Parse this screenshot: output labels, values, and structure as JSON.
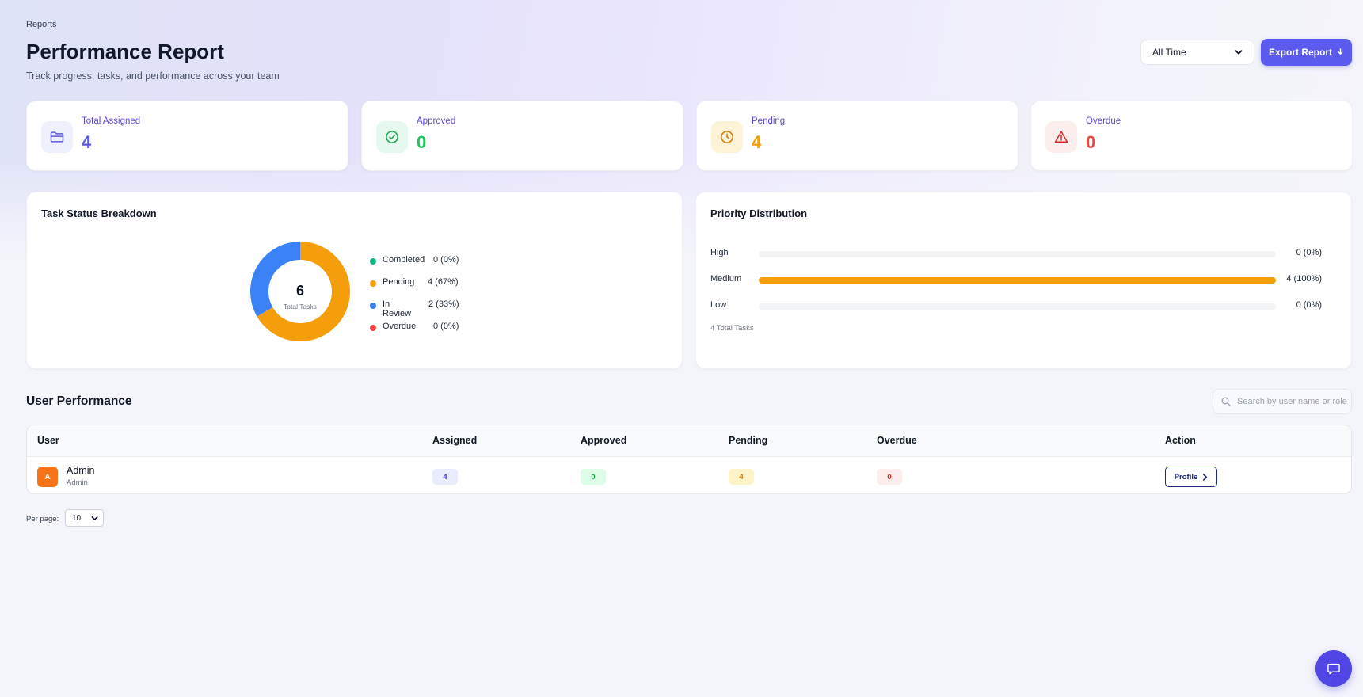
{
  "header": {
    "breadcrumb": "Reports",
    "title": "Performance Report",
    "subtitle": "Track progress, tasks, and performance across your team",
    "range_select": {
      "value": "All Time"
    },
    "export_label": "Export Report"
  },
  "stats": [
    {
      "label": "Total Assigned",
      "value": "4",
      "icon": "folder-icon",
      "color": "#5b5bd6",
      "icon_bg": "#eef0fb"
    },
    {
      "label": "Approved",
      "value": "0",
      "icon": "check-circle-icon",
      "color": "#22c55e",
      "icon_bg": "#e6f9ee"
    },
    {
      "label": "Pending",
      "value": "4",
      "icon": "clock-icon",
      "color": "#f59e0b",
      "icon_bg": "#fdf3d6"
    },
    {
      "label": "Overdue",
      "value": "0",
      "icon": "warning-icon",
      "color": "#ef4444",
      "icon_bg": "#fdeeee"
    }
  ],
  "status_breakdown": {
    "title": "Task Status Breakdown",
    "total_value": "6",
    "total_label": "Total Tasks",
    "legend": [
      {
        "label": "Completed",
        "value": "0 (0%)",
        "color": "#10b981"
      },
      {
        "label": "Pending",
        "value": "4 (67%)",
        "color": "#f59e0b"
      },
      {
        "label": "In Review",
        "value": "2 (33%)",
        "color": "#3b82f6"
      },
      {
        "label": "Overdue",
        "value": "0 (0%)",
        "color": "#ef4444"
      }
    ]
  },
  "priority": {
    "title": "Priority Distribution",
    "rows": [
      {
        "label": "High",
        "value": "0 (0%)"
      },
      {
        "label": "Medium",
        "value": "4 (100%)"
      },
      {
        "label": "Low",
        "value": "0 (0%)"
      }
    ],
    "total": "4 Total Tasks"
  },
  "chart_data": [
    {
      "type": "pie",
      "categories": [
        "Completed",
        "Pending",
        "In Review",
        "Overdue"
      ],
      "values": [
        0,
        4,
        2,
        0
      ],
      "title": "Task Status Breakdown",
      "colors": [
        "#10b981",
        "#f59e0b",
        "#3b82f6",
        "#ef4444"
      ]
    },
    {
      "type": "bar",
      "categories": [
        "High",
        "Medium",
        "Low"
      ],
      "values": [
        0,
        4,
        0
      ],
      "title": "Priority Distribution",
      "ylim": [
        0,
        4
      ],
      "colors": [
        "#f59e0b"
      ]
    }
  ],
  "user_performance": {
    "title": "User Performance",
    "search_placeholder": "Search by user name or role",
    "columns": [
      "User",
      "Assigned",
      "Approved",
      "Pending",
      "Overdue",
      "Action"
    ],
    "rows": [
      {
        "avatar": "A",
        "name": "Admin",
        "role": "Admin",
        "assigned": "4",
        "approved": "0",
        "pending": "4",
        "overdue": "0",
        "action": "Profile"
      }
    ]
  },
  "pagination": {
    "per_page_label": "Per page:",
    "per_page_value": "10"
  }
}
